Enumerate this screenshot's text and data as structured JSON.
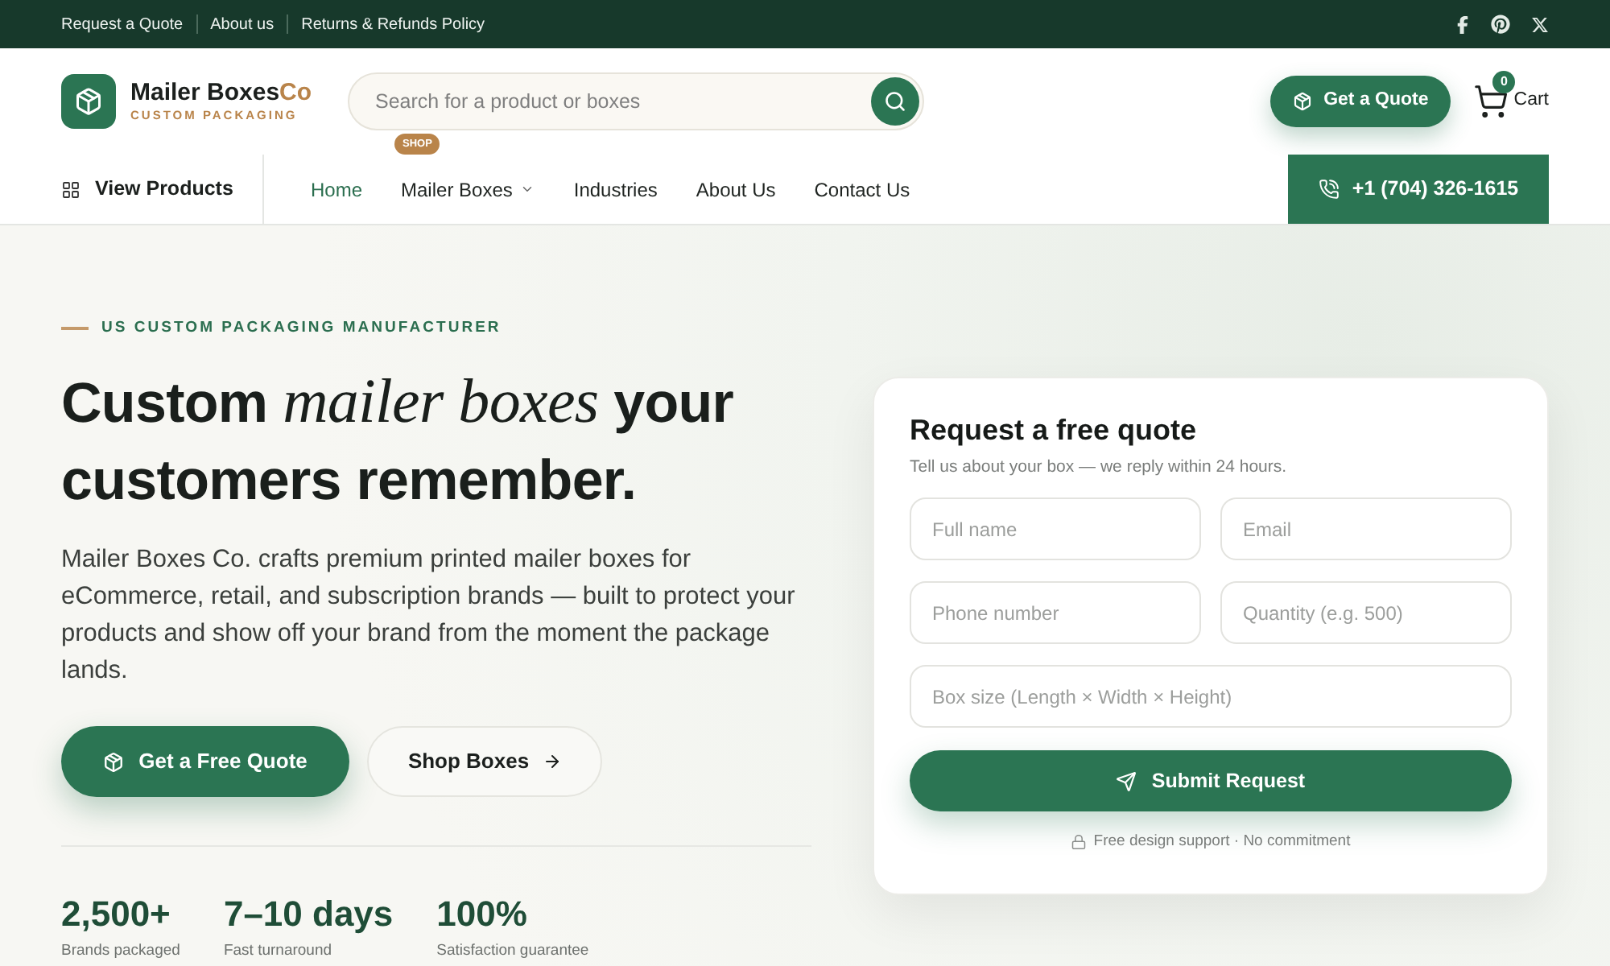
{
  "top_bar": {
    "links": [
      "Request a Quote",
      "About us",
      "Returns & Refunds Policy"
    ]
  },
  "header": {
    "logo": {
      "name": "Mailer Boxes",
      "suffix": "Co",
      "tagline": "CUSTOM PACKAGING"
    },
    "search": {
      "placeholder": "Search for a product or boxes"
    },
    "search_badge": "SHOP",
    "quote_button": "Get a Quote",
    "cart": {
      "count": "0",
      "label": "Cart"
    }
  },
  "nav": {
    "view_products": "View Products",
    "items": [
      {
        "label": "Home",
        "selected": true,
        "dropdown": false
      },
      {
        "label": "Mailer Boxes",
        "selected": false,
        "dropdown": true
      },
      {
        "label": "Industries",
        "selected": false,
        "dropdown": false
      },
      {
        "label": "About Us",
        "selected": false,
        "dropdown": false
      },
      {
        "label": "Contact Us",
        "selected": false,
        "dropdown": false
      }
    ],
    "phone": "+1 (704) 326-1615"
  },
  "hero": {
    "eyebrow": "US CUSTOM PACKAGING MANUFACTURER",
    "heading": "Custom *mailer boxes* your customers remember.",
    "description": "Mailer Boxes Co. crafts premium printed mailer boxes for eCommerce, retail, and subscription brands — built to protect your products and show off your brand from the moment the package lands.",
    "buttons": [
      {
        "label": "Get a Free Quote",
        "kind": "primary"
      },
      {
        "label": "Shop Boxes",
        "kind": "secondary"
      }
    ],
    "stats": [
      {
        "value": "2,500+",
        "label": "Brands packaged"
      },
      {
        "value": "7–10 days",
        "label": "Fast turnaround"
      },
      {
        "value": "100%",
        "label": "Satisfaction guarantee"
      }
    ]
  },
  "quote_form": {
    "title": "Request a free quote",
    "subtitle": "Tell us about your box — we reply within 24 hours.",
    "fields": [
      {
        "placeholder": "Full name"
      },
      {
        "placeholder": "Email"
      },
      {
        "placeholder": "Phone number"
      },
      {
        "placeholder": "Quantity (e.g. 500)"
      },
      {
        "placeholder": "Box size (Length × Width × Height)"
      }
    ],
    "submit": "Submit Request",
    "note": "Free design support · No commitment"
  }
}
